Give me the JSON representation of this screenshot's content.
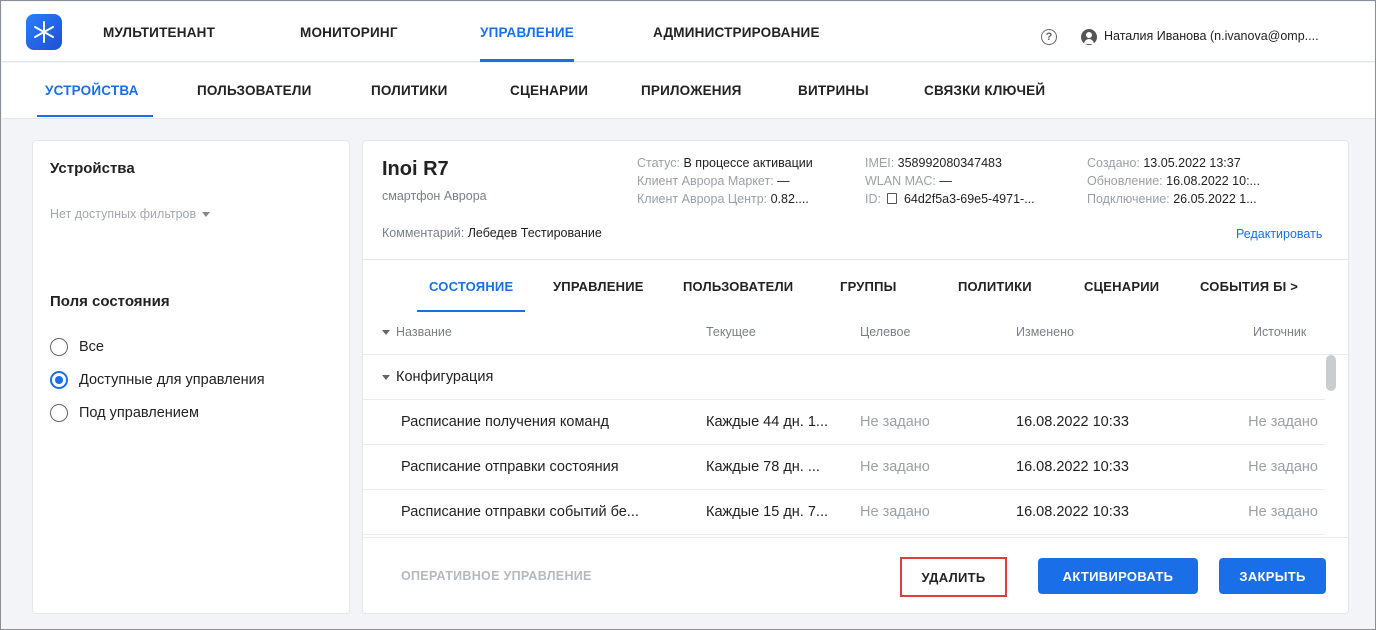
{
  "top_nav": {
    "items": [
      "МУЛЬТИТЕНАНТ",
      "МОНИТОРИНГ",
      "УПРАВЛЕНИЕ",
      "АДМИНИСТРИРОВАНИЕ"
    ],
    "help_glyph": "?",
    "user": "Наталия Иванова (n.ivanova@omp...."
  },
  "sub_tabs": [
    "УСТРОЙСТВА",
    "ПОЛЬЗОВАТЕЛИ",
    "ПОЛИТИКИ",
    "СЦЕНАРИИ",
    "ПРИЛОЖЕНИЯ",
    "ВИТРИНЫ",
    "СВЯЗКИ КЛЮЧЕЙ"
  ],
  "left_panel": {
    "title": "Устройства",
    "filter": "Нет доступных фильтров",
    "section": "Поля состояния",
    "radios": [
      "Все",
      "Доступные для управления",
      "Под управлением"
    ],
    "selected_radio": 1
  },
  "device": {
    "name": "Inoi R7",
    "type": "смартфон Аврора",
    "comment_label": "Комментарий:",
    "comment_value": "Лебедев Тестирование",
    "status_label": "Статус:",
    "status_value": "В процессе активации",
    "market_label": "Клиент Аврора Маркет:",
    "market_value": "—",
    "center_label": "Клиент Аврора Центр:",
    "center_value": "0.82....",
    "imei_label": "IMEI:",
    "imei_value": "358992080347483",
    "wlan_label": "WLAN MAC:",
    "wlan_value": "—",
    "id_label": "ID:",
    "id_value": "64d2f5a3-69e5-4971-...",
    "created_label": "Создано:",
    "created_value": "13.05.2022 13:37",
    "updated_label": "Обновление:",
    "updated_value": "16.08.2022 10:...",
    "connected_label": "Подключение:",
    "connected_value": "26.05.2022 1...",
    "edit": "Редактировать"
  },
  "inner_tabs": [
    "СОСТОЯНИЕ",
    "УПРАВЛЕНИЕ",
    "ПОЛЬЗОВАТЕЛИ",
    "ГРУППЫ",
    "ПОЛИТИКИ",
    "СЦЕНАРИИ",
    "СОБЫТИЯ БІ >"
  ],
  "table": {
    "headers": [
      "Название",
      "Текущее",
      "Целевое",
      "Изменено",
      "Источник"
    ],
    "group": "Конфигурация",
    "rows": [
      [
        "Расписание получения команд",
        "Каждые 44 дн. 1...",
        "Не задано",
        "16.08.2022 10:33",
        "Не задано"
      ],
      [
        "Расписание отправки состояния",
        "Каждые 78 дн. ...",
        "Не задано",
        "16.08.2022 10:33",
        "Не задано"
      ],
      [
        "Расписание отправки событий бе...",
        "Каждые 15 дн. 7...",
        "Не задано",
        "16.08.2022 10:33",
        "Не задано"
      ]
    ]
  },
  "footer": {
    "operative": "ОПЕРАТИВНОЕ УПРАВЛЕНИЕ",
    "delete": "УДАЛИТЬ",
    "activate": "АКТИВИРОВАТЬ",
    "close": "ЗАКРЫТЬ"
  },
  "colors": {
    "accent": "#1a6fe8",
    "highlight_border": "#e23b3b"
  }
}
